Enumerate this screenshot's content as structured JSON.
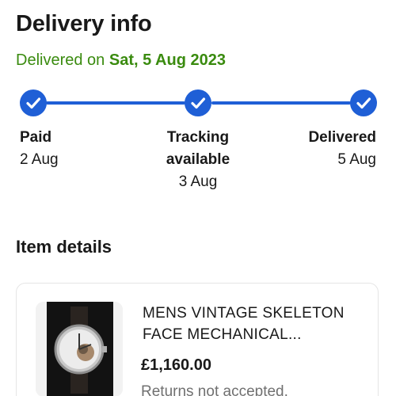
{
  "header": {
    "title": "Delivery info"
  },
  "delivery_status": {
    "prefix": "Delivered on",
    "date": "Sat, 5 Aug 2023",
    "color": "#3a8b0f"
  },
  "tracker": {
    "accent_color": "#1f5fd6",
    "steps": [
      {
        "name": "Paid",
        "date": "2 Aug",
        "completed": true,
        "icon": "check-icon"
      },
      {
        "name": "Tracking available",
        "date": "3 Aug",
        "completed": true,
        "icon": "check-icon"
      },
      {
        "name": "Delivered",
        "date": "5 Aug",
        "completed": true,
        "icon": "check-icon"
      }
    ]
  },
  "item_section": {
    "title": "Item details",
    "item": {
      "title": "MENS VINTAGE SKELETON FACE MECHANICAL...",
      "price": "£1,160.00",
      "returns": "Returns not accepted.",
      "image": "watch-thumbnail"
    }
  }
}
